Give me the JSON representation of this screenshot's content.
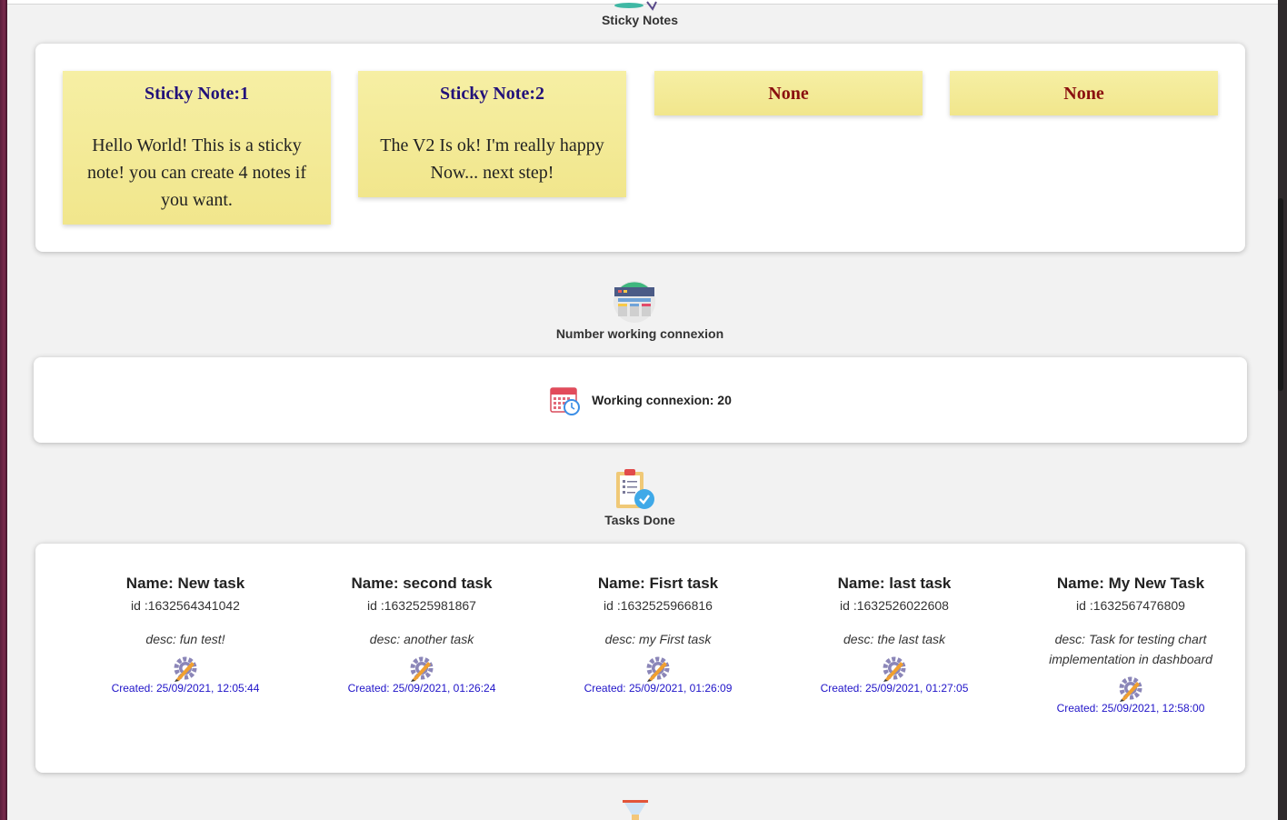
{
  "sections": {
    "sticky": {
      "title": "Sticky Notes"
    },
    "connexion": {
      "title": "Number working connexion",
      "label": "Working connexion: 20"
    },
    "tasks": {
      "title": "Tasks Done"
    }
  },
  "notes": [
    {
      "title": "Sticky Note:1",
      "body": "Hello World! This is a sticky note! you can create 4 notes if you want."
    },
    {
      "title": "Sticky Note:2",
      "body": "The V2 Is ok! I'm really happy Now... next step!"
    },
    {
      "title": "None",
      "body": ""
    },
    {
      "title": "None",
      "body": ""
    }
  ],
  "tasks": [
    {
      "name": "Name: New task",
      "id": "id :1632564341042",
      "desc": "desc: fun test!",
      "created": "Created: 25/09/2021, 12:05:44"
    },
    {
      "name": "Name: second task",
      "id": "id :1632525981867",
      "desc": "desc: another task",
      "created": "Created: 25/09/2021, 01:26:24"
    },
    {
      "name": "Name: Fisrt task",
      "id": "id :1632525966816",
      "desc": "desc: my First task",
      "created": "Created: 25/09/2021, 01:26:09"
    },
    {
      "name": "Name: last task",
      "id": "id :1632526022608",
      "desc": "desc: the last task",
      "created": "Created: 25/09/2021, 01:27:05"
    },
    {
      "name": "Name: My New Task",
      "id": "id :1632567476809",
      "desc": "desc: Task for testing chart implementation in dashboard",
      "created": "Created: 25/09/2021, 12:58:00"
    }
  ],
  "icons": {
    "sticky": "sticky-notes-icon",
    "connexion": "dashboard-icon",
    "calendar": "calendar-clock-icon",
    "tasks": "clipboard-check-icon",
    "task": "gear-pencil-icon",
    "next": "funnel-icon"
  },
  "colors": {
    "note_bg": "#f3ea96",
    "note_title": "#22117a",
    "note_empty": "#8a0f0f",
    "created": "#1f13c8"
  }
}
